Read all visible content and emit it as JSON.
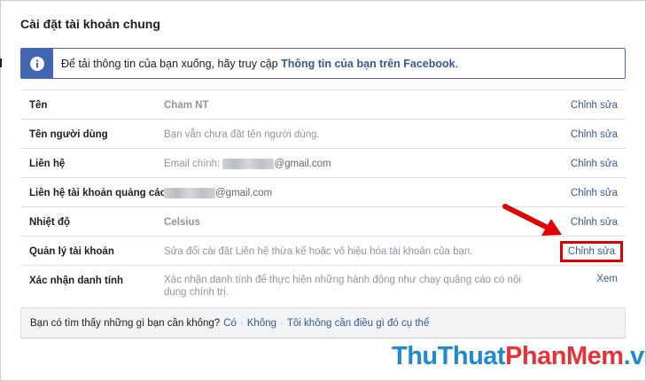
{
  "page": {
    "title": "Cài đặt tài khoản chung"
  },
  "info": {
    "text": "Để tải thông tin của bạn xuống, hãy truy cập ",
    "link": "Thông tin của bạn trên Facebook",
    "suffix": ".",
    "icon": "info-icon"
  },
  "rows": [
    {
      "label": "Tên",
      "value": "Cham NT",
      "action": "Chỉnh sửa"
    },
    {
      "label": "Tên người dùng",
      "value": "Bạn vẫn chưa đặt tên người dùng.",
      "action": "Chỉnh sửa"
    },
    {
      "label": "Liên hệ",
      "value_prefix": "Email chính: ",
      "value_suffix": "@gmail.com",
      "action": "Chỉnh sửa"
    },
    {
      "label": "Liên hệ tài khoản quảng cáo",
      "value_suffix": "@gmail.com",
      "action": "Chỉnh sửa"
    },
    {
      "label": "Nhiệt độ",
      "value": "Celsius",
      "action": "Chỉnh sửa"
    },
    {
      "label": "Quản lý tài khoản",
      "value": "Sửa đổi cài đặt Liên hệ thừa kế hoặc vô hiệu hóa tài khoản của bạn.",
      "action": "Chỉnh sửa"
    },
    {
      "label": "Xác nhận danh tính",
      "value": "Xác nhận danh tính để thực hiện những hành động như chạy quảng cáo có nội dung chính trị.",
      "action": "Xem"
    }
  ],
  "footer": {
    "question": "Bạn có tìm thấy những gì bạn cần không?",
    "options": [
      "Có",
      "Không",
      "Tôi không cần điều gì đó cụ thể"
    ],
    "separator": "·"
  },
  "watermark": {
    "part1": "ThuThuat",
    "part2": "PhanMem",
    "part3": ".vn"
  },
  "colors": {
    "accent": "#4267b2",
    "link": "#365899",
    "highlight": "#e00000"
  }
}
